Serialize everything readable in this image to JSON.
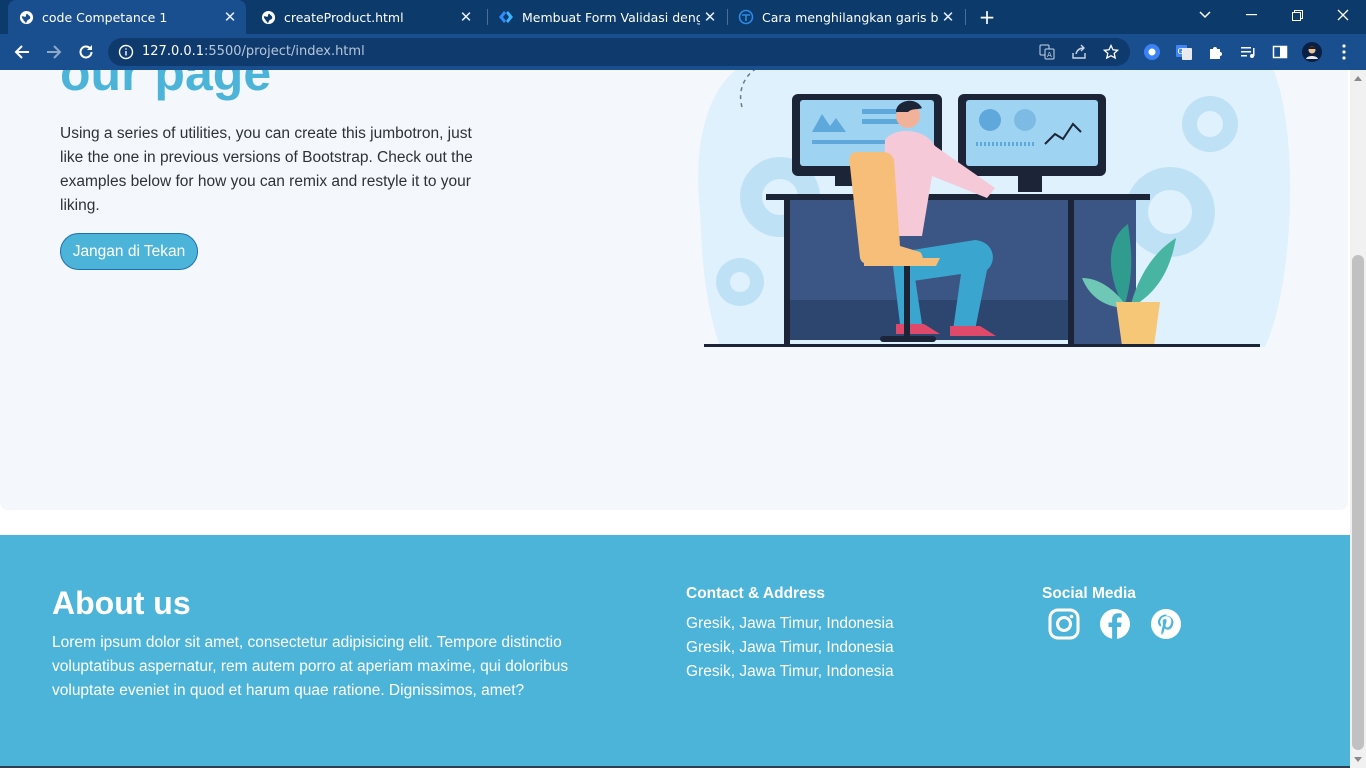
{
  "browser": {
    "tabs": [
      {
        "title": "code Competance 1",
        "icon": "globe-icon",
        "active": true
      },
      {
        "title": "createProduct.html",
        "icon": "globe-icon",
        "active": false
      },
      {
        "title": "Membuat Form Validasi dengan J",
        "icon": "diamond-code-icon",
        "active": false
      },
      {
        "title": "Cara menghilangkan garis bawah",
        "icon": "site-logo-icon",
        "active": false
      }
    ],
    "url_host": "127.0.0.1",
    "url_rest": ":5500/project/index.html"
  },
  "hero": {
    "title": "our page",
    "text": "Using a series of utilities, you can create this jumbotron, just like the one in previous versions of Bootstrap. Check out the examples below for how you can remix and restyle it to your liking.",
    "button_label": "Jangan di Tekan"
  },
  "footer": {
    "about_title": "About us",
    "about_text": "Lorem ipsum dolor sit amet, consectetur adipisicing elit. Tempore distinctio voluptatibus aspernatur, rem autem porro at aperiam maxime, qui doloribus voluptate eveniet in quod et harum quae ratione. Dignissimos, amet?",
    "contact_title": "Contact & Address",
    "contact_lines": [
      "Gresik, Jawa Timur, Indonesia",
      "Gresik, Jawa Timur, Indonesia",
      "Gresik, Jawa Timur, Indonesia"
    ],
    "social_title": "Social Media",
    "social_icons": [
      "instagram-icon",
      "facebook-icon",
      "pinterest-icon"
    ]
  },
  "colors": {
    "accent": "#4db4d9",
    "tabstrip": "#0b3a6b",
    "toolbar": "#1a4f8f"
  }
}
